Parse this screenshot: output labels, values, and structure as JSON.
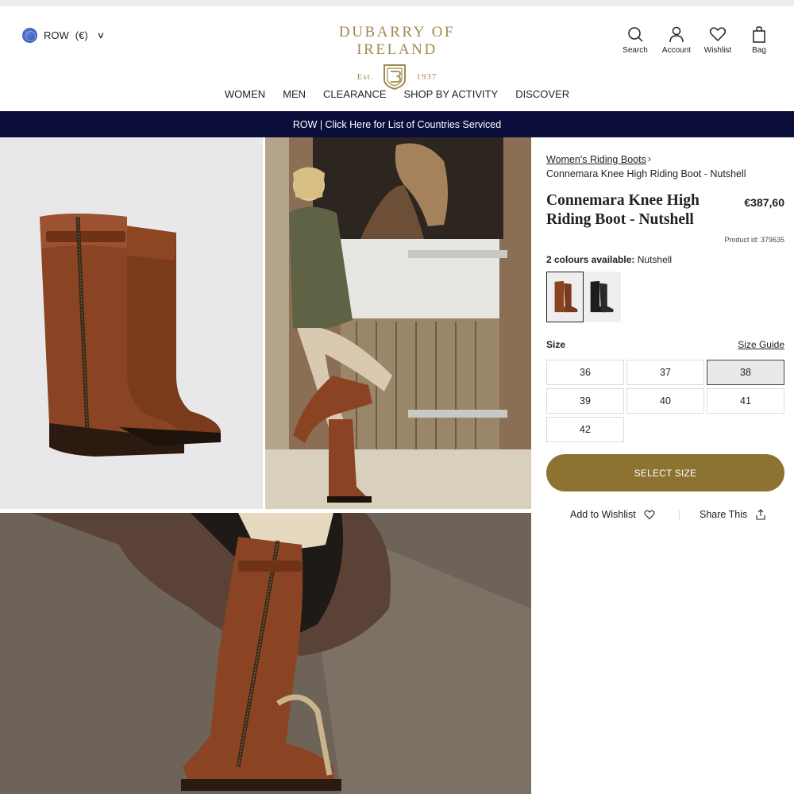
{
  "header": {
    "region": "ROW",
    "currency": "(€)",
    "logo_name": "DUBARRY OF IRELAND",
    "logo_est": "Est.",
    "logo_year": "1937",
    "utils": [
      {
        "label": "Search",
        "icon": "search-icon"
      },
      {
        "label": "Account",
        "icon": "account-icon"
      },
      {
        "label": "Wishlist",
        "icon": "heart-icon"
      },
      {
        "label": "Bag",
        "icon": "bag-icon"
      }
    ]
  },
  "nav": [
    "WOMEN",
    "MEN",
    "CLEARANCE",
    "SHOP BY ACTIVITY",
    "DISCOVER"
  ],
  "banner": "ROW | Click Here for List of Countries Serviced",
  "product": {
    "breadcrumb_parent": "Women's Riding Boots",
    "breadcrumb_sep": "›",
    "breadcrumb_current": "Connemara Knee High Riding Boot - Nutshell",
    "title": "Connemara Knee High Riding Boot - Nutshell",
    "price": "€387,60",
    "product_id": "Product id:  379635",
    "colours_label": "2 colours available:",
    "colour_selected": "Nutshell",
    "size_label": "Size",
    "size_guide": "Size Guide",
    "sizes": [
      "36",
      "37",
      "38",
      "39",
      "40",
      "41",
      "42"
    ],
    "selected_size": "38",
    "select_button": "SELECT SIZE",
    "wishlist": "Add to Wishlist",
    "share": "Share This"
  },
  "colors": {
    "brand_gold": "#a08a4e",
    "button_gold": "#8c7332",
    "banner_navy": "#0b0e3a",
    "boot_brown": "#8a4424"
  }
}
